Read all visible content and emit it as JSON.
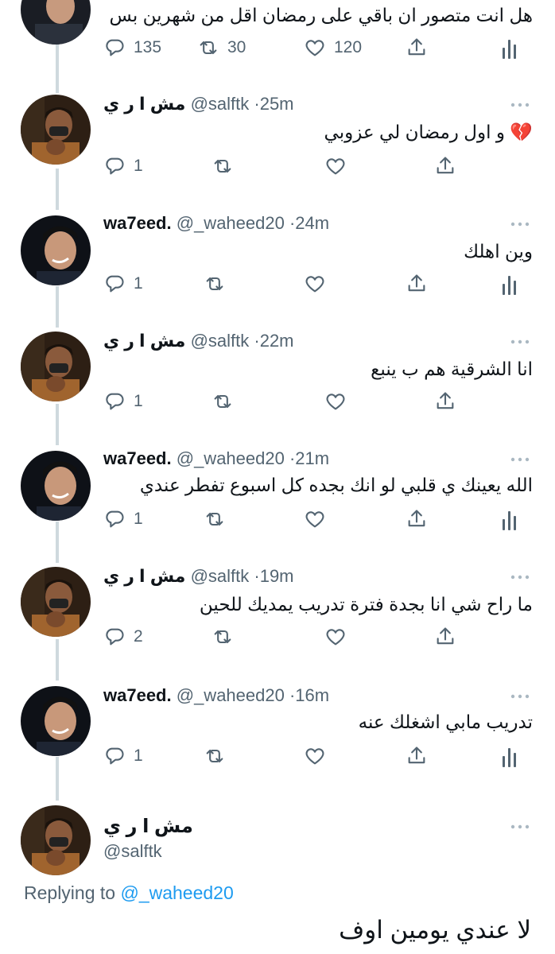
{
  "colors": {
    "accent": "#1d9bf0",
    "secondary_text": "#536471",
    "thread_line": "#cfd9de",
    "heart_broken": "#e0245e"
  },
  "icons": {
    "reply": "reply-icon",
    "retweet": "retweet-icon",
    "like": "heart-icon",
    "share": "share-icon",
    "analytics": "analytics-icon",
    "more": "more-icon"
  },
  "top_tweet": {
    "text": "هل انت متصور ان باقي على رمضان اقل من شهرين بس",
    "replies": "135",
    "retweets": "30",
    "likes": "120"
  },
  "tweets": [
    {
      "name": "مش ا ر ي",
      "handle": "@salftk",
      "time": "25m",
      "text": "و اول رمضان لي عزوبي",
      "replies": "1"
    },
    {
      "name": "wa7eed.",
      "handle": "@_waheed20",
      "time": "24m",
      "text": "وين اهلك",
      "replies": "1"
    },
    {
      "name": "مش ا ر ي",
      "handle": "@salftk",
      "time": "22m",
      "text": "انا الشرقية هم ب ينبع",
      "replies": "1"
    },
    {
      "name": "wa7eed.",
      "handle": "@_waheed20",
      "time": "21m",
      "text": "الله يعينك ي قلبي لو انك بجده كل اسبوع تفطر عندي",
      "replies": "1"
    },
    {
      "name": "مش ا ر ي",
      "handle": "@salftk",
      "time": "19m",
      "text": "ما راح شي انا بجدة فترة تدريب يمديك للحين",
      "replies": "2"
    },
    {
      "name": "wa7eed.",
      "handle": "@_waheed20",
      "time": "16m",
      "text": "تدريب مابي اشغلك عنه",
      "replies": "1"
    }
  ],
  "main_tweet": {
    "name": "مش ا ر ي",
    "handle": "@salftk",
    "replying_label": "Replying to",
    "replying_to": "@_waheed20",
    "text": "لا عندي يومين اوف"
  }
}
